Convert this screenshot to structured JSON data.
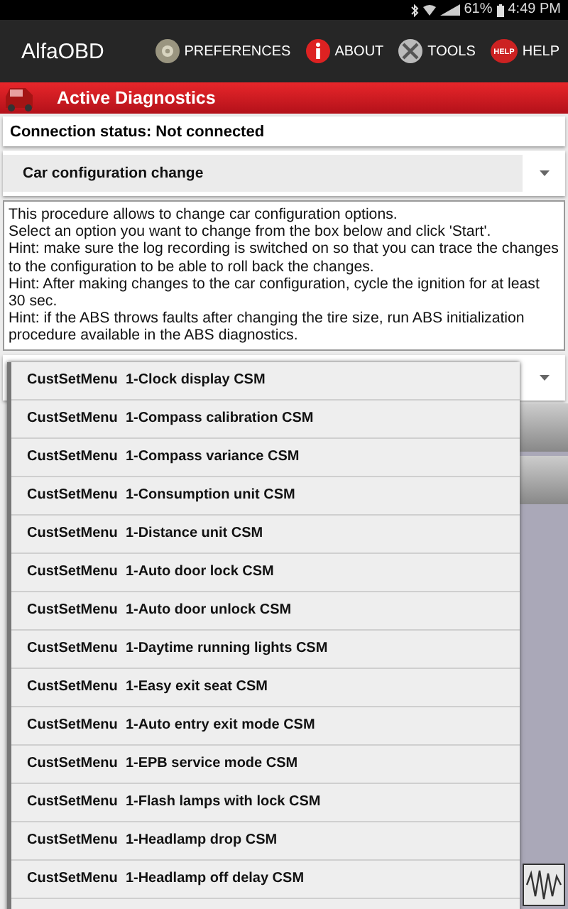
{
  "status_bar": {
    "battery": "61%",
    "time": "4:49 PM"
  },
  "toolbar": {
    "title": "AlfaOBD",
    "actions": [
      {
        "label": "PREFERENCES",
        "kind": "preferences"
      },
      {
        "label": "ABOUT",
        "kind": "about"
      },
      {
        "label": "TOOLS",
        "kind": "tools"
      },
      {
        "label": "HELP",
        "kind": "help",
        "icon_text": "HELP"
      }
    ]
  },
  "section_header": {
    "title": "Active Diagnostics"
  },
  "connection_status": "Connection status: Not connected",
  "procedure_dropdown": {
    "value": "Car configuration change"
  },
  "description": [
    "This procedure allows to change car configuration options.",
    "Select an option you want to change from the box below and click 'Start'.",
    "Hint: make sure the log recording is switched on so that you can trace the changes to the configuration to be able to roll back the changes.",
    "Hint: After making changes to the car configuration, cycle the ignition for at least 30 sec.",
    "Hint: if the ABS throws faults after changing the tire size, run ABS initialization procedure available in the ABS diagnostics."
  ],
  "option_dropdown": {
    "expanded": true,
    "options": [
      "CustSetMenu  1-Clock display CSM",
      "CustSetMenu  1-Compass calibration CSM",
      "CustSetMenu  1-Compass variance CSM",
      "CustSetMenu  1-Consumption unit CSM",
      "CustSetMenu  1-Distance unit CSM",
      "CustSetMenu  1-Auto door lock CSM",
      "CustSetMenu  1-Auto door unlock CSM",
      "CustSetMenu  1-Daytime running lights CSM",
      "CustSetMenu  1-Easy exit seat CSM",
      "CustSetMenu  1-Auto entry exit mode CSM",
      "CustSetMenu  1-EPB service mode CSM",
      "CustSetMenu  1-Flash lamps with lock CSM",
      "CustSetMenu  1-Headlamp drop CSM",
      "CustSetMenu  1-Headlamp off delay CSM"
    ]
  }
}
